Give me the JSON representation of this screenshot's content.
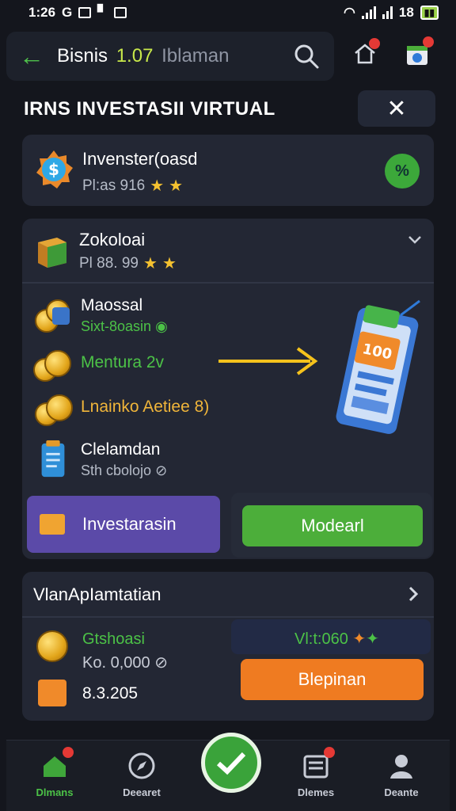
{
  "status": {
    "time": "1:26",
    "g": "G",
    "battery_pct": "18"
  },
  "header": {
    "title": "Bisnis",
    "pct": "1.07",
    "muted": "Iblaman"
  },
  "section": {
    "title": "IRNS INVESTASII VIRTUAL"
  },
  "card1": {
    "title": "Invenster(oasd",
    "sub": "Pl:as 916"
  },
  "card2": {
    "title": "Zokoloai",
    "sub": "Pl 88. 99",
    "items": [
      {
        "t1": "Maossal",
        "t2": "Sixt-8oasin"
      },
      {
        "t1": "Mentura 2v",
        "t2": ""
      },
      {
        "t1": "Lnainko Aetiee 8)",
        "t2": ""
      },
      {
        "t1": "Clelamdan",
        "t2": "Sth cbolojo"
      }
    ],
    "phone_value": "100",
    "btn_invest": "Investarasin",
    "btn_model": "Modearl"
  },
  "card3": {
    "title": "VlanApIamtatian",
    "r1_title": "Gtshoasi",
    "r1_sub": "Ko. 0,000",
    "r2_value": "8.3.205",
    "right_label": "Vl:t:060",
    "btn": "Blepinan"
  },
  "nav": [
    {
      "label": "Dlmans"
    },
    {
      "label": "Deearet"
    },
    {
      "label": "Dlemes"
    },
    {
      "label": "Deante"
    }
  ],
  "colors": {
    "accent_green": "#4cae3a",
    "purple": "#5b4aa8",
    "orange": "#ef7b21"
  }
}
